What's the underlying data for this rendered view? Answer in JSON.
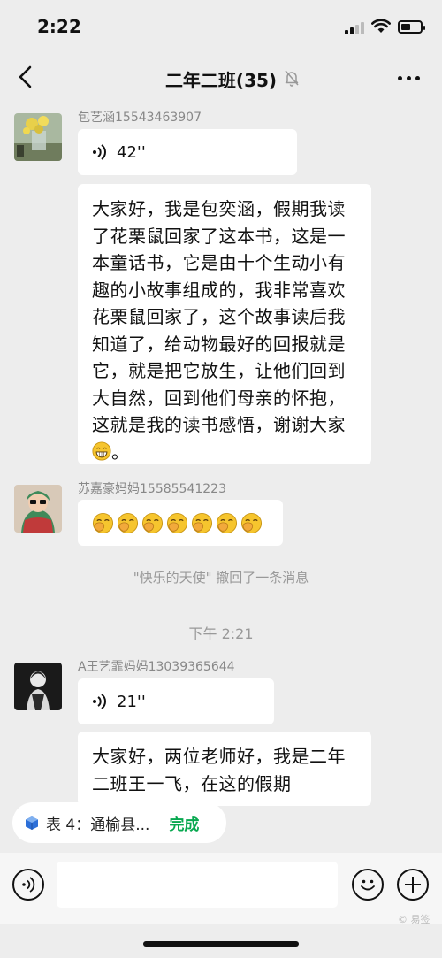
{
  "status_bar": {
    "time": "2:22"
  },
  "header": {
    "title": "二年二班(35)"
  },
  "messages": [
    {
      "sender": "包艺涵15543463907",
      "voice_duration": "42''",
      "text": "大家好，我是包奕涵，假期我读了花栗鼠回家了这本书，这是一本童话书，它是由十个生动小有趣的小故事组成的，我非常喜欢花栗鼠回家了，这个故事读后我知道了，给动物最好的回报就是它，就是把它放生，让他们回到大自然，回到他们母亲的怀抱，这就是我的读书感悟，谢谢大家",
      "text_end": "。"
    },
    {
      "sender": "苏嘉豪妈妈15585541223",
      "emoji_count": 7
    },
    {
      "sender": "A王艺霏妈妈13039365644",
      "voice_duration": "21''",
      "text": "大家好，两位老师好，我是二年二班王一飞，在这的假期"
    }
  ],
  "recall_notice": "\"快乐的天使\" 撤回了一条消息",
  "time_divider": "下午 2:21",
  "chip": {
    "label": "表 4：通榆县...",
    "action": "完成"
  },
  "input": {
    "placeholder": ""
  },
  "watermark": "© 易签",
  "icons": {
    "back": "chevron-left-icon",
    "mute": "bell-off-icon",
    "more": "more-dots-icon",
    "voice": "voice-wave-icon",
    "emoji": "smile-icon",
    "plus": "plus-icon",
    "form": "cube-icon"
  },
  "colors": {
    "background": "#ededed",
    "bubble": "#ffffff",
    "accent_green": "#07a84f",
    "muted_text": "#999999"
  }
}
